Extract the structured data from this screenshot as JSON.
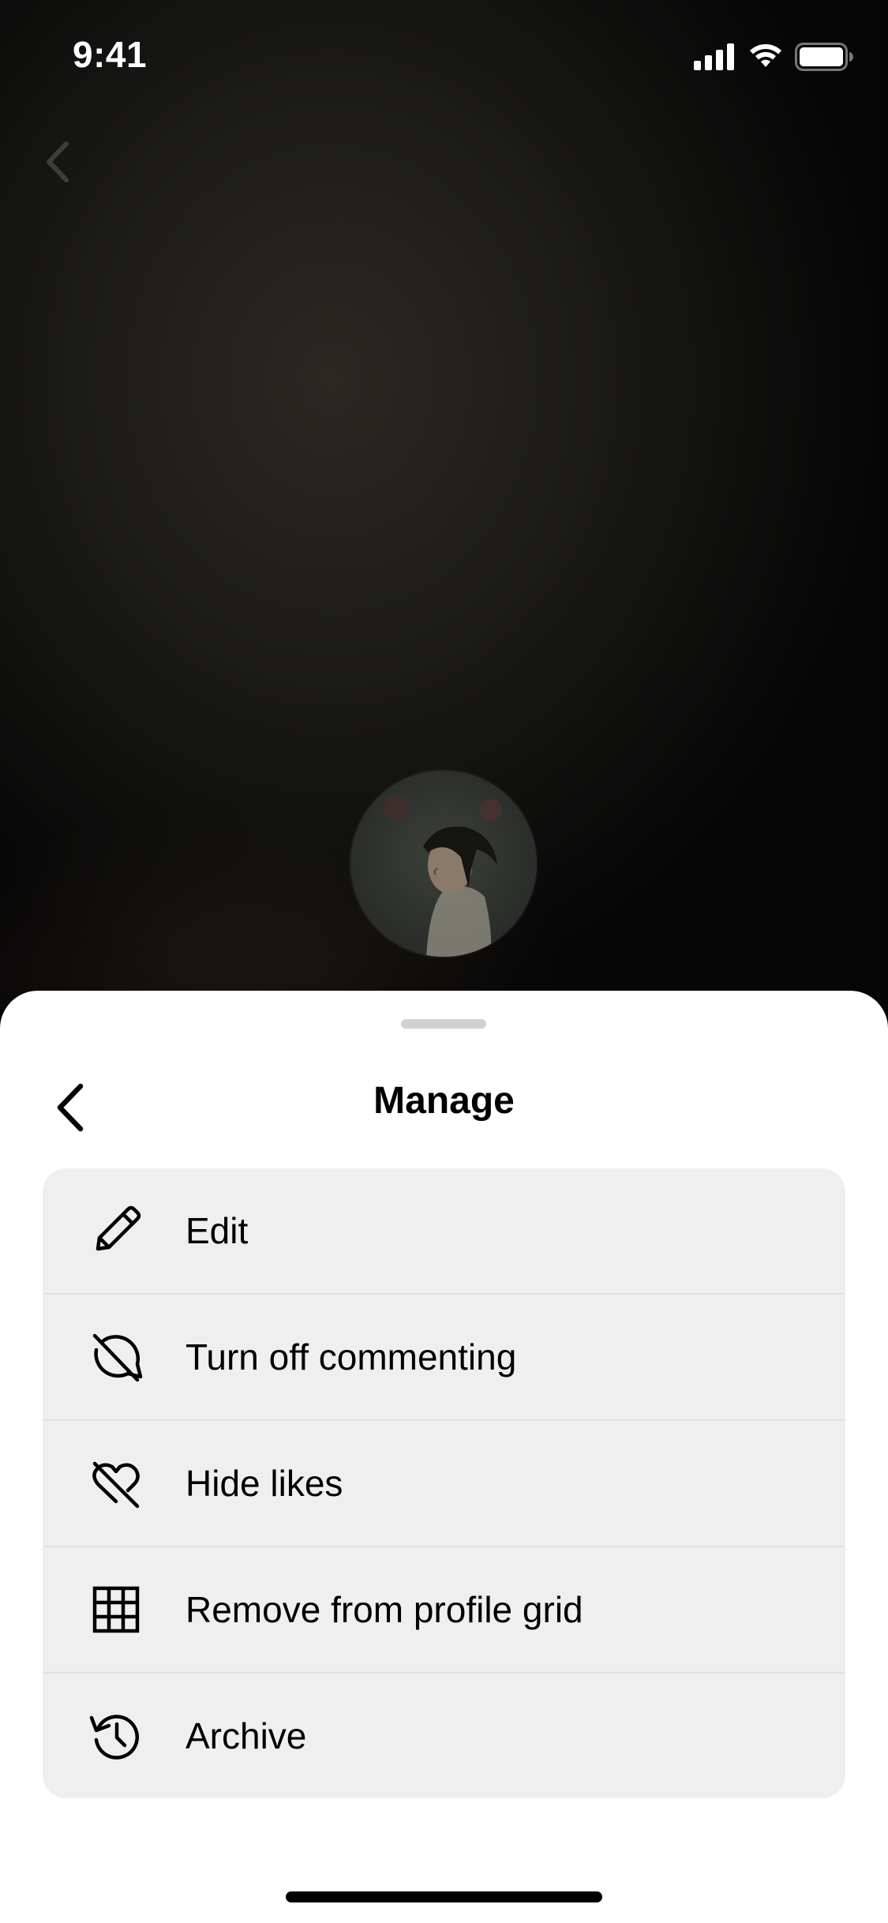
{
  "status_bar": {
    "time": "9:41"
  },
  "story": {
    "back_icon": "chevron-left-icon",
    "avatar": "profile-avatar"
  },
  "sheet": {
    "title": "Manage",
    "back_icon": "chevron-left-icon",
    "items": [
      {
        "label": "Edit",
        "icon": "pencil-icon"
      },
      {
        "label": "Turn off commenting",
        "icon": "comment-off-icon"
      },
      {
        "label": "Hide likes",
        "icon": "heart-off-icon"
      },
      {
        "label": "Remove from profile grid",
        "icon": "grid-icon"
      },
      {
        "label": "Archive",
        "icon": "archive-clock-icon"
      }
    ]
  },
  "colors": {
    "sheet_background": "#ffffff",
    "menu_background": "#efefef",
    "divider": "#e1e1e1",
    "text": "#000000"
  }
}
